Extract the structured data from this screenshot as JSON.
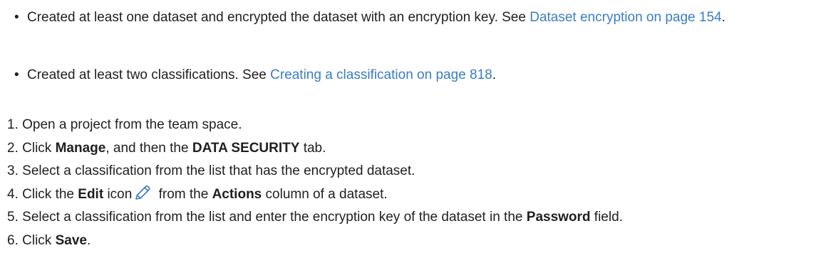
{
  "prerequisites": [
    {
      "text_before": "Created at least one dataset and encrypted the dataset with an encryption key. See ",
      "link_text": "Dataset encryption on page 154",
      "text_after": "."
    },
    {
      "text_before": "Created at least two classifications. See ",
      "link_text": "Creating a classification on page 818",
      "text_after": "."
    }
  ],
  "steps": [
    {
      "num": "1.",
      "text": "Open a project from the team space."
    },
    {
      "num": "2.",
      "pre": "Click ",
      "b1": "Manage",
      "mid": ", and then the ",
      "b2": "DATA SECURITY",
      "post": " tab."
    },
    {
      "num": "3.",
      "text": "Select a classification from the list that has the encrypted dataset."
    },
    {
      "num": "4.",
      "pre": "Click the ",
      "b1": "Edit",
      "mid": " icon",
      "icon": "pencil-icon",
      "mid2": " from the ",
      "b2": "Actions",
      "post": " column of a dataset."
    },
    {
      "num": "5.",
      "pre": "Select a classification from the list and enter the encryption key of the dataset in the ",
      "b1": "Password",
      "post": " field."
    },
    {
      "num": "6.",
      "pre": "Click ",
      "b1": "Save",
      "post": "."
    }
  ],
  "colors": {
    "text": "#1f1f1f",
    "link": "#3a7dc3",
    "icon_stroke": "#3a7dc3"
  }
}
